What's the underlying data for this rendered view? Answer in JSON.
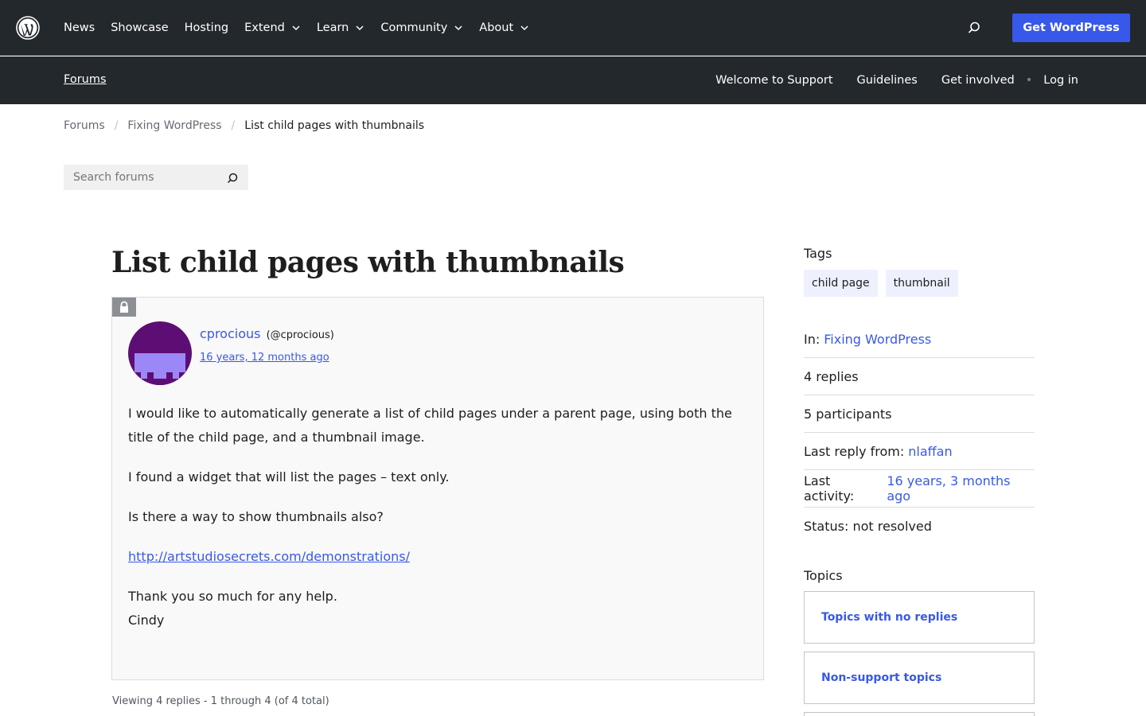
{
  "global_nav": {
    "items": [
      {
        "label": "News"
      },
      {
        "label": "Showcase"
      },
      {
        "label": "Hosting"
      },
      {
        "label": "Extend"
      },
      {
        "label": "Learn"
      },
      {
        "label": "Community"
      },
      {
        "label": "About"
      }
    ],
    "get_wordpress_label": "Get WordPress"
  },
  "forums_nav": {
    "forums_label": "Forums",
    "links": [
      "Welcome to Support",
      "Guidelines",
      "Get involved",
      "Log in"
    ],
    "separator": "•"
  },
  "breadcrumb": {
    "items": [
      "Forums",
      "Fixing WordPress",
      "List child pages with thumbnails"
    ],
    "separator": "/"
  },
  "search": {
    "placeholder": "Search forums"
  },
  "topic": {
    "title": "List child pages with thumbnails",
    "author_name": "cprocious",
    "author_handle": "(@cprocious)",
    "date": "16 years, 12 months ago",
    "paragraphs": [
      "I would like to automatically generate a list of child pages under a parent page, using both the title of the child page, and a thumbnail image.",
      "I found a widget that will list the pages – text only.",
      "Is there a way to show thumbnails also?"
    ],
    "link": "http://artstudiosecrets.com/demonstrations/",
    "closing_1": "Thank you so much for any help.",
    "closing_2": "Cindy"
  },
  "viewing_text": "Viewing 4 replies - 1 through 4 (of 4 total)",
  "sidebar": {
    "tags_heading": "Tags",
    "tags": [
      "child page",
      "thumbnail"
    ],
    "in_label": "In:",
    "in_value": "Fixing WordPress",
    "replies": "4 replies",
    "participants": "5 participants",
    "last_reply_label": "Last reply from:",
    "last_reply_value": "nlaffan",
    "last_activity_label": "Last activity:",
    "last_activity_value": "16 years, 3 months ago",
    "status": "Status: not resolved",
    "topics_heading": "Topics",
    "topic_links": [
      "Topics with no replies",
      "Non-support topics"
    ]
  },
  "colors": {
    "header_bg": "#23282d",
    "accent": "#3858e9",
    "avatar_bg": "#5c0e74",
    "avatar_face": "#9b87f5"
  }
}
